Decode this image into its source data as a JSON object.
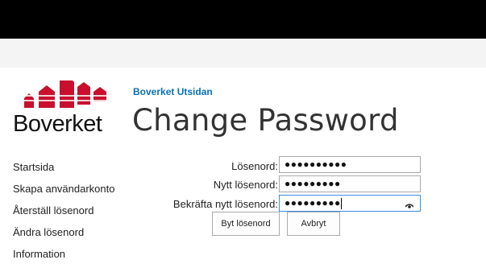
{
  "logo": {
    "text": "Boverket"
  },
  "site": {
    "link_text": "Boverket Utsidan"
  },
  "page": {
    "title": "Change Password"
  },
  "nav": {
    "items": [
      {
        "label": "Startsida"
      },
      {
        "label": "Skapa användarkonto"
      },
      {
        "label": "Återställ lösenord"
      },
      {
        "label": "Ändra lösenord"
      },
      {
        "label": "Information"
      }
    ]
  },
  "form": {
    "password_label": "Lösenord:",
    "password_value": "●●●●●●●●●●",
    "new_password_label": "Nytt lösenord:",
    "new_password_value": "●●●●●●●●●",
    "confirm_label": "Bekräfta nytt lösenord:",
    "confirm_value": "●●●●●●●●●",
    "submit_label": "Byt lösenord",
    "cancel_label": "Avbryt"
  },
  "colors": {
    "brand_red": "#c8102e",
    "link_blue": "#0a6fb7"
  },
  "icons": {
    "reveal": "eye-icon"
  }
}
